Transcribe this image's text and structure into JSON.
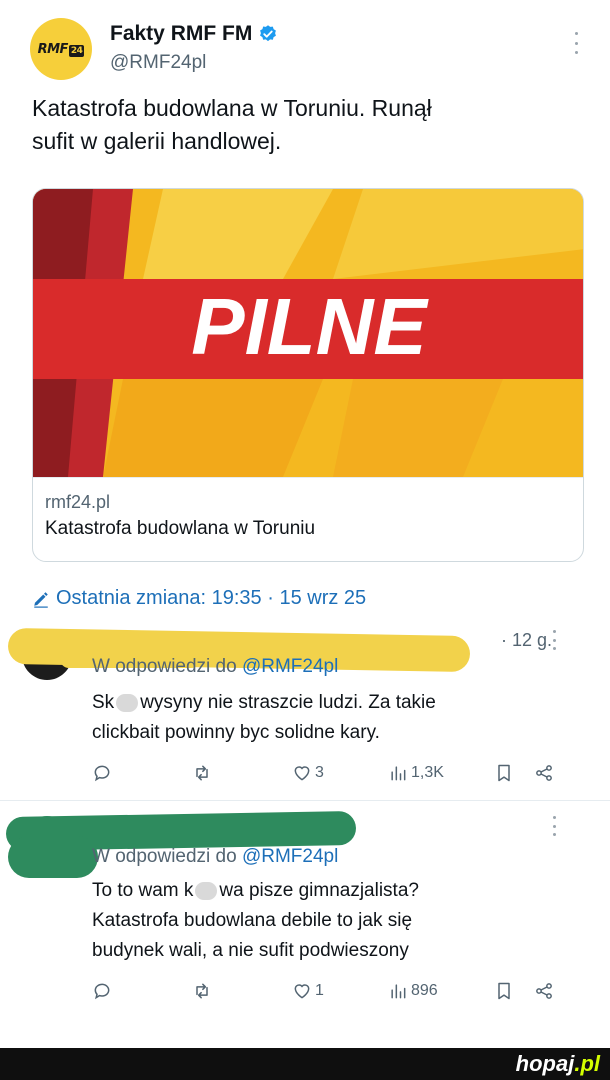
{
  "account": {
    "display_name": "Fakty RMF FM",
    "handle": "@RMF24pl",
    "logo_text": "RMF",
    "logo_badge": "24"
  },
  "tweet": {
    "text_line1": "Katastrofa budowlana w Toruniu. Runął",
    "text_line2": "sufit w galerii handlowej."
  },
  "card": {
    "banner_text": "PILNE",
    "domain": "rmf24.pl",
    "title": "Katastrofa budowlana w Toruniu"
  },
  "edited": {
    "label": "Ostatnia zmiana: 19:35 · 15 wrz 25"
  },
  "replies": [
    {
      "time": "· 12 g.",
      "replying_prefix": "W odpowiedzi do ",
      "replying_to": "@RMF24pl",
      "text_line1_a": "Sk",
      "text_line1_b": "wysyny nie straszcie ludzi. Za takie",
      "text_line2": "clickbait powinny byc solidne kary.",
      "actions": {
        "replies": "",
        "retweets": "",
        "likes": "3",
        "views": "1,3K"
      }
    },
    {
      "replying_prefix": "W odpowiedzi do ",
      "replying_to": "@RMF24pl",
      "text_line1_a": "To to wam k",
      "text_line1_b": "wa pisze gimnazjalista?",
      "text_line2": "Katastrofa budowlana debile to jak się",
      "text_line3": "budynek wali, a nie sufit podwieszony",
      "actions": {
        "replies": "",
        "retweets": "",
        "likes": "1",
        "views": "896"
      }
    }
  ],
  "footer": {
    "brand": "hopaj",
    "tld": ".pl"
  },
  "colors": {
    "accent": "#1d6fb8",
    "verified": "#1d9bf0",
    "banner_red": "#d92b2b",
    "banner_yellow": "#f6c42c",
    "scribble_1": "#f2d24b",
    "scribble_2": "#2e8b5e"
  }
}
